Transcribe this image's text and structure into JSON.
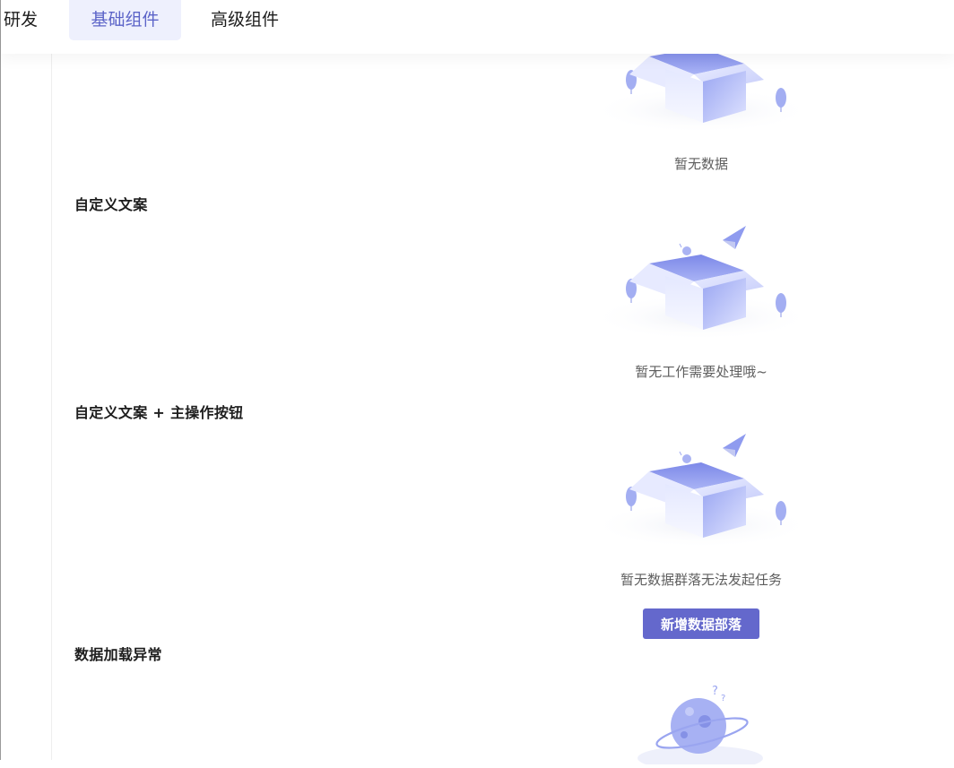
{
  "tabs": [
    {
      "label": "研发",
      "active": false
    },
    {
      "label": "基础组件",
      "active": true
    },
    {
      "label": "高级组件",
      "active": false
    }
  ],
  "sections": {
    "default": {
      "description": "暂无数据"
    },
    "custom_text": {
      "title": "自定义文案",
      "description": "暂无工作需要处理哦~"
    },
    "custom_text_action": {
      "title": "自定义文案 + 主操作按钮",
      "description": "暂无数据群落无法发起任务",
      "button_label": "新增数据部落"
    },
    "load_error": {
      "title": "数据加载异常"
    }
  },
  "colors": {
    "accent": "#6468cc",
    "active_tab_bg": "#eef0fd",
    "illustration": "#8f9bef"
  },
  "icons": [
    "empty-box-icon",
    "paper-plane-icon",
    "snail-icon",
    "tree-icon",
    "planet-icon",
    "question-mark-icon"
  ]
}
